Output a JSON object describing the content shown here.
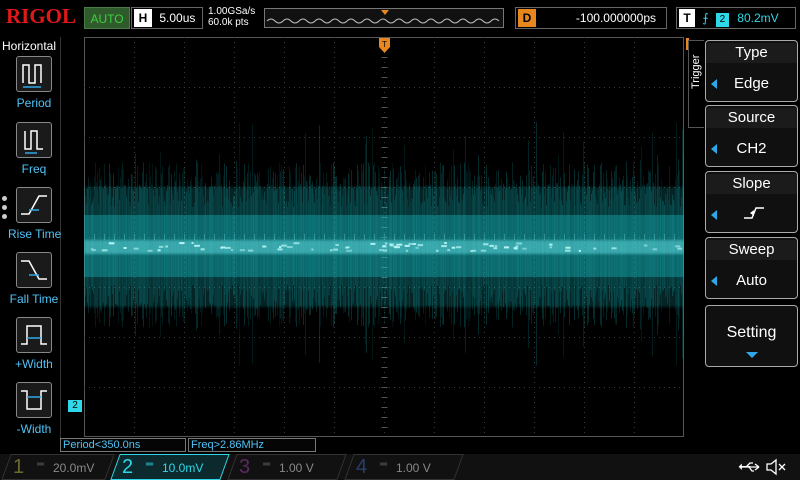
{
  "brand": "RIGOL",
  "run_status": "AUTO",
  "horizontal": {
    "label": "H",
    "timebase": "5.00us"
  },
  "acquisition": {
    "sample_rate": "1.00GSa/s",
    "memory_depth": "60.0k pts"
  },
  "delay": {
    "label": "D",
    "value": "-100.000000ps"
  },
  "trigger_status": {
    "label": "T",
    "edge_symbol": "⨍",
    "channel": "2",
    "level": "80.2mV"
  },
  "left_menu": {
    "title": "Horizontal",
    "items": [
      {
        "label": "Period",
        "icon": "period-icon"
      },
      {
        "label": "Freq",
        "icon": "frequency-icon"
      },
      {
        "label": "Rise Time",
        "icon": "rise-time-icon"
      },
      {
        "label": "Fall Time",
        "icon": "fall-time-icon"
      },
      {
        "label": "+Width",
        "icon": "positive-width-icon"
      },
      {
        "label": "-Width",
        "icon": "negative-width-icon"
      }
    ]
  },
  "trigger_menu": {
    "tab_label": "Trigger",
    "type": {
      "title": "Type",
      "value": "Edge"
    },
    "source": {
      "title": "Source",
      "value": "CH2"
    },
    "slope": {
      "title": "Slope",
      "value": "rising-edge-icon"
    },
    "sweep": {
      "title": "Sweep",
      "value": "Auto"
    },
    "setting": {
      "title": "Setting"
    }
  },
  "channel_marker": "2",
  "measurements": [
    {
      "text": "Period<350.0ns"
    },
    {
      "text": "Freq>2.86MHz"
    }
  ],
  "channels": [
    {
      "num": "1",
      "scale": "20.0mV",
      "color": "#d8d84a",
      "active": false
    },
    {
      "num": "2",
      "scale": "10.0mV",
      "color": "#2fd8e8",
      "active": true
    },
    {
      "num": "3",
      "scale": "1.00 V",
      "color": "#d04ad8",
      "active": false
    },
    {
      "num": "4",
      "scale": "1.00 V",
      "color": "#3a6ae8",
      "active": false
    }
  ],
  "colors": {
    "trace": "#19c6cc",
    "delay_accent": "#e8871e",
    "menu_arrow": "#2fa8e8"
  }
}
